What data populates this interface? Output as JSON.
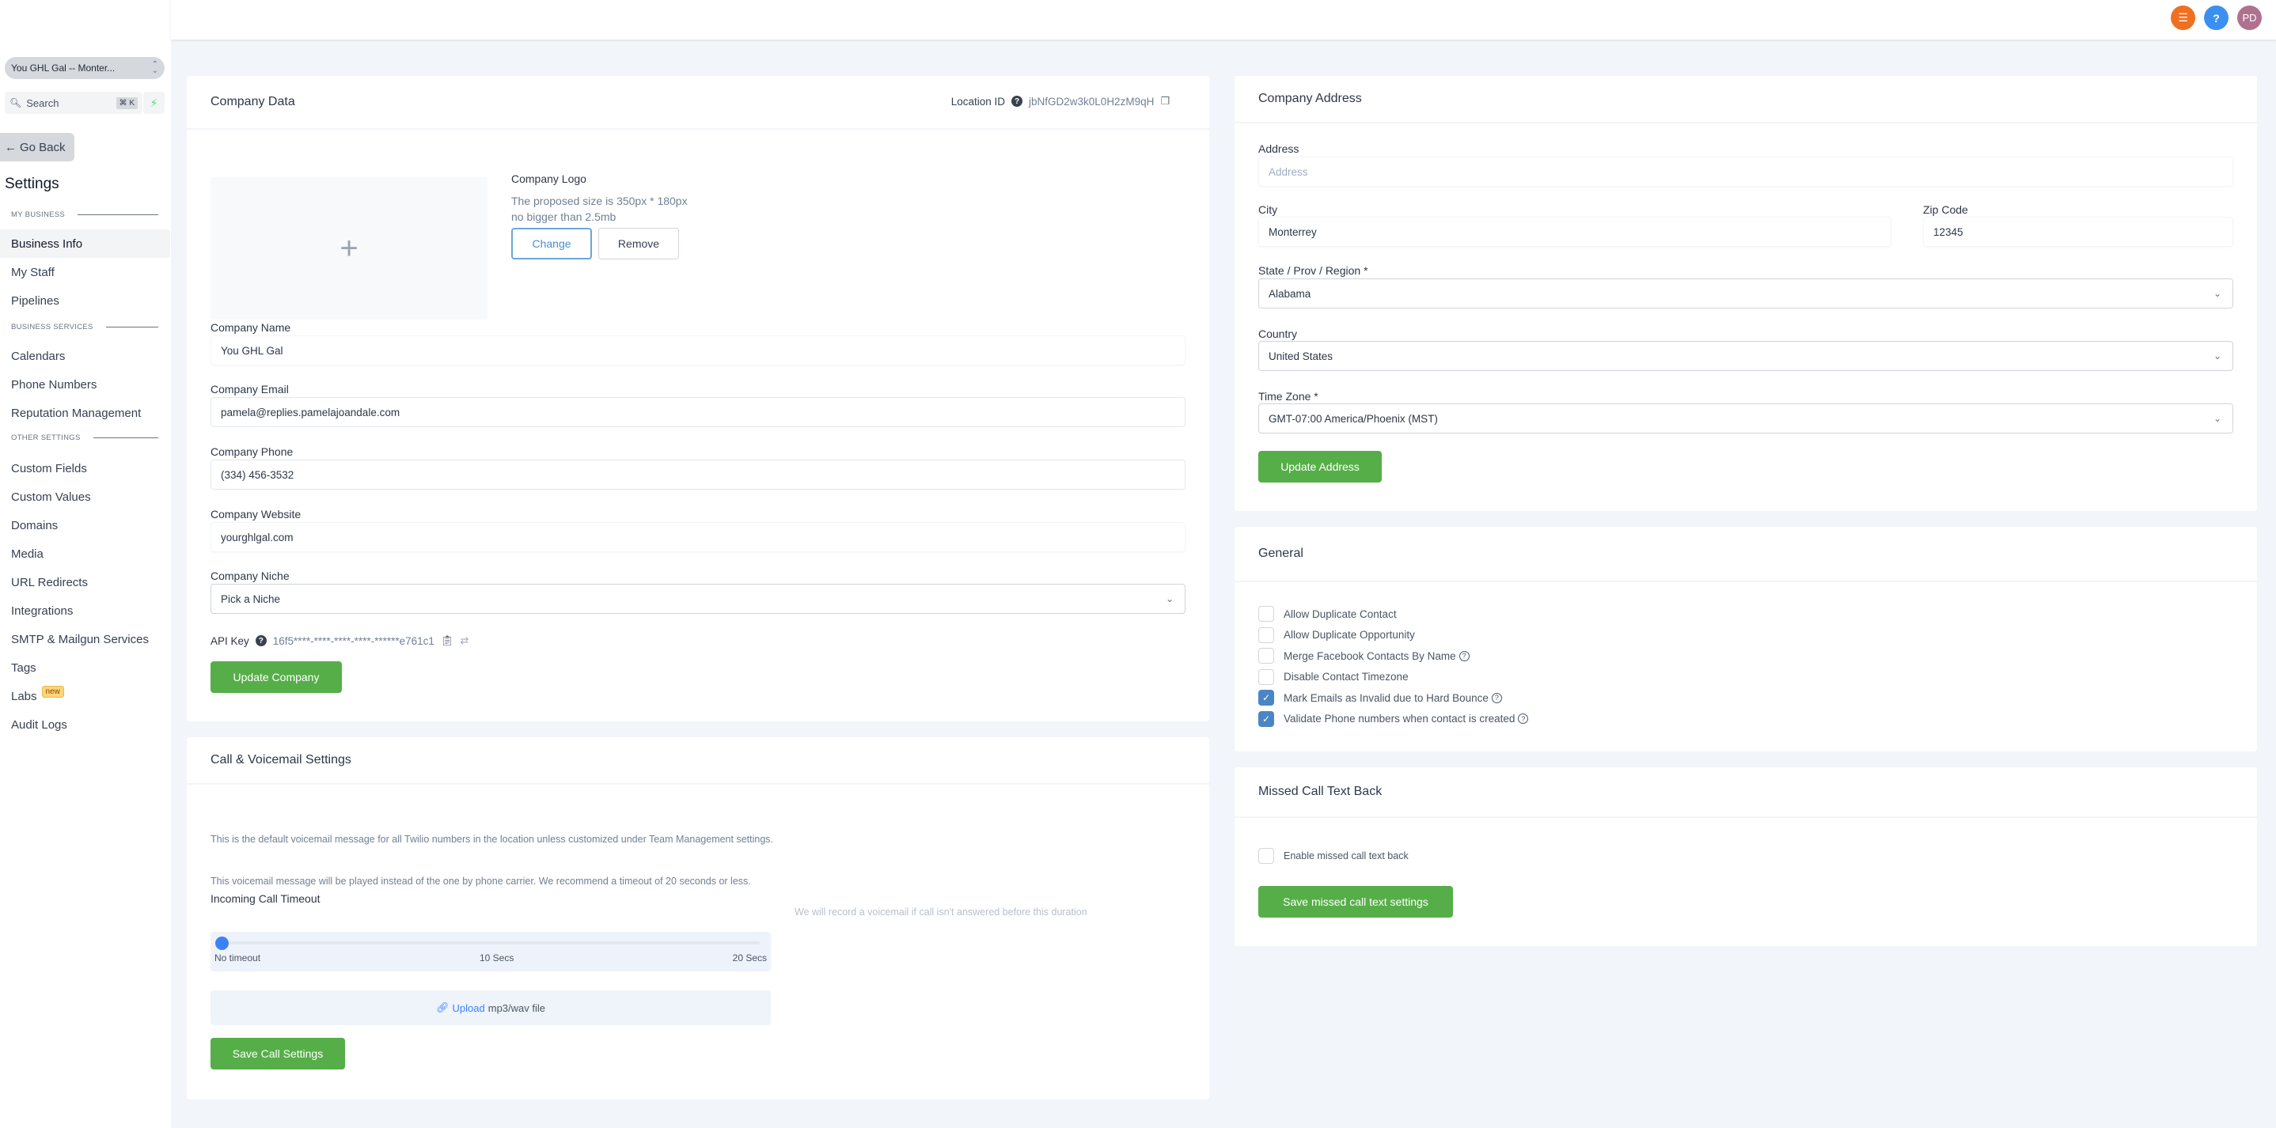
{
  "sidebar": {
    "location_switcher": "You GHL Gal -- Monter...",
    "search_placeholder": "Search",
    "search_shortcut": "⌘ K",
    "go_back": "Go Back",
    "title": "Settings",
    "sections": [
      {
        "label": "MY BUSINESS",
        "items": [
          "Business Info",
          "My Staff",
          "Pipelines"
        ]
      },
      {
        "label": "BUSINESS SERVICES",
        "items": [
          "Calendars",
          "Phone Numbers",
          "Reputation Management"
        ]
      },
      {
        "label": "OTHER SETTINGS",
        "items": [
          "Custom Fields",
          "Custom Values",
          "Domains",
          "Media",
          "URL Redirects",
          "Integrations",
          "SMTP & Mailgun Services",
          "Tags",
          "Labs",
          "Audit Logs"
        ]
      }
    ],
    "active_item": "Business Info",
    "labs_badge": "new"
  },
  "topbar": {
    "icons": [
      "task-list-icon",
      "help-icon"
    ],
    "avatar_initials": "PD"
  },
  "company_data": {
    "title": "Company Data",
    "location_id_label": "Location ID",
    "location_id": "jbNfGD2w3k0L0H2zM9qH",
    "logo_title": "Company Logo",
    "logo_hint_1": "The proposed size is 350px * 180px",
    "logo_hint_2": "no bigger than 2.5mb",
    "change_button": "Change",
    "remove_button": "Remove",
    "fields": {
      "name_label": "Company Name",
      "name_value": "You GHL Gal",
      "email_label": "Company Email",
      "email_value": "pamela@replies.pamelajoandale.com",
      "phone_label": "Company Phone",
      "phone_value": "(334) 456-3532",
      "website_label": "Company Website",
      "website_value": "yourghlgal.com",
      "niche_label": "Company Niche",
      "niche_value": "Pick a Niche"
    },
    "api_key_label": "API Key",
    "api_key": "16f5****-****-****-****-******e761c1",
    "update_button": "Update Company"
  },
  "call_settings": {
    "title": "Call & Voicemail Settings",
    "text_1": "This is the default voicemail message for all Twilio numbers in the location unless customized under Team Management settings.",
    "text_2": "This voicemail message will be played instead of the one by phone carrier. We recommend a timeout of 20 seconds or less.",
    "timeout_label": "Incoming Call Timeout",
    "timeout_hint": "We will record a voicemail if call isn't answered before this duration",
    "slider_labels": [
      "No timeout",
      "10 Secs",
      "20 Secs"
    ],
    "slider_value_secs": 0,
    "upload_link": "Upload",
    "upload_text": "mp3/wav file",
    "save_button": "Save Call Settings"
  },
  "address": {
    "title": "Company Address",
    "address_label": "Address",
    "address_placeholder": "Address",
    "city_label": "City",
    "city_value": "Monterrey",
    "zip_label": "Zip Code",
    "zip_value": "12345",
    "state_label": "State / Prov / Region *",
    "state_value": "Alabama",
    "country_label": "Country",
    "country_value": "United States",
    "timezone_label": "Time Zone *",
    "timezone_value": "GMT-07:00 America/Phoenix (MST)",
    "update_button": "Update Address"
  },
  "general": {
    "title": "General",
    "options": [
      {
        "label": "Allow Duplicate Contact",
        "checked": false,
        "help": false
      },
      {
        "label": "Allow Duplicate Opportunity",
        "checked": false,
        "help": false
      },
      {
        "label": "Merge Facebook Contacts By Name",
        "checked": false,
        "help": true
      },
      {
        "label": "Disable Contact Timezone",
        "checked": false,
        "help": false
      },
      {
        "label": "Mark Emails as Invalid due to Hard Bounce",
        "checked": true,
        "help": true
      },
      {
        "label": "Validate Phone numbers when contact is created",
        "checked": true,
        "help": true
      }
    ]
  },
  "missed_call": {
    "title": "Missed Call Text Back",
    "enable_label": "Enable missed call text back",
    "enabled": false,
    "save_button": "Save missed call text settings"
  }
}
